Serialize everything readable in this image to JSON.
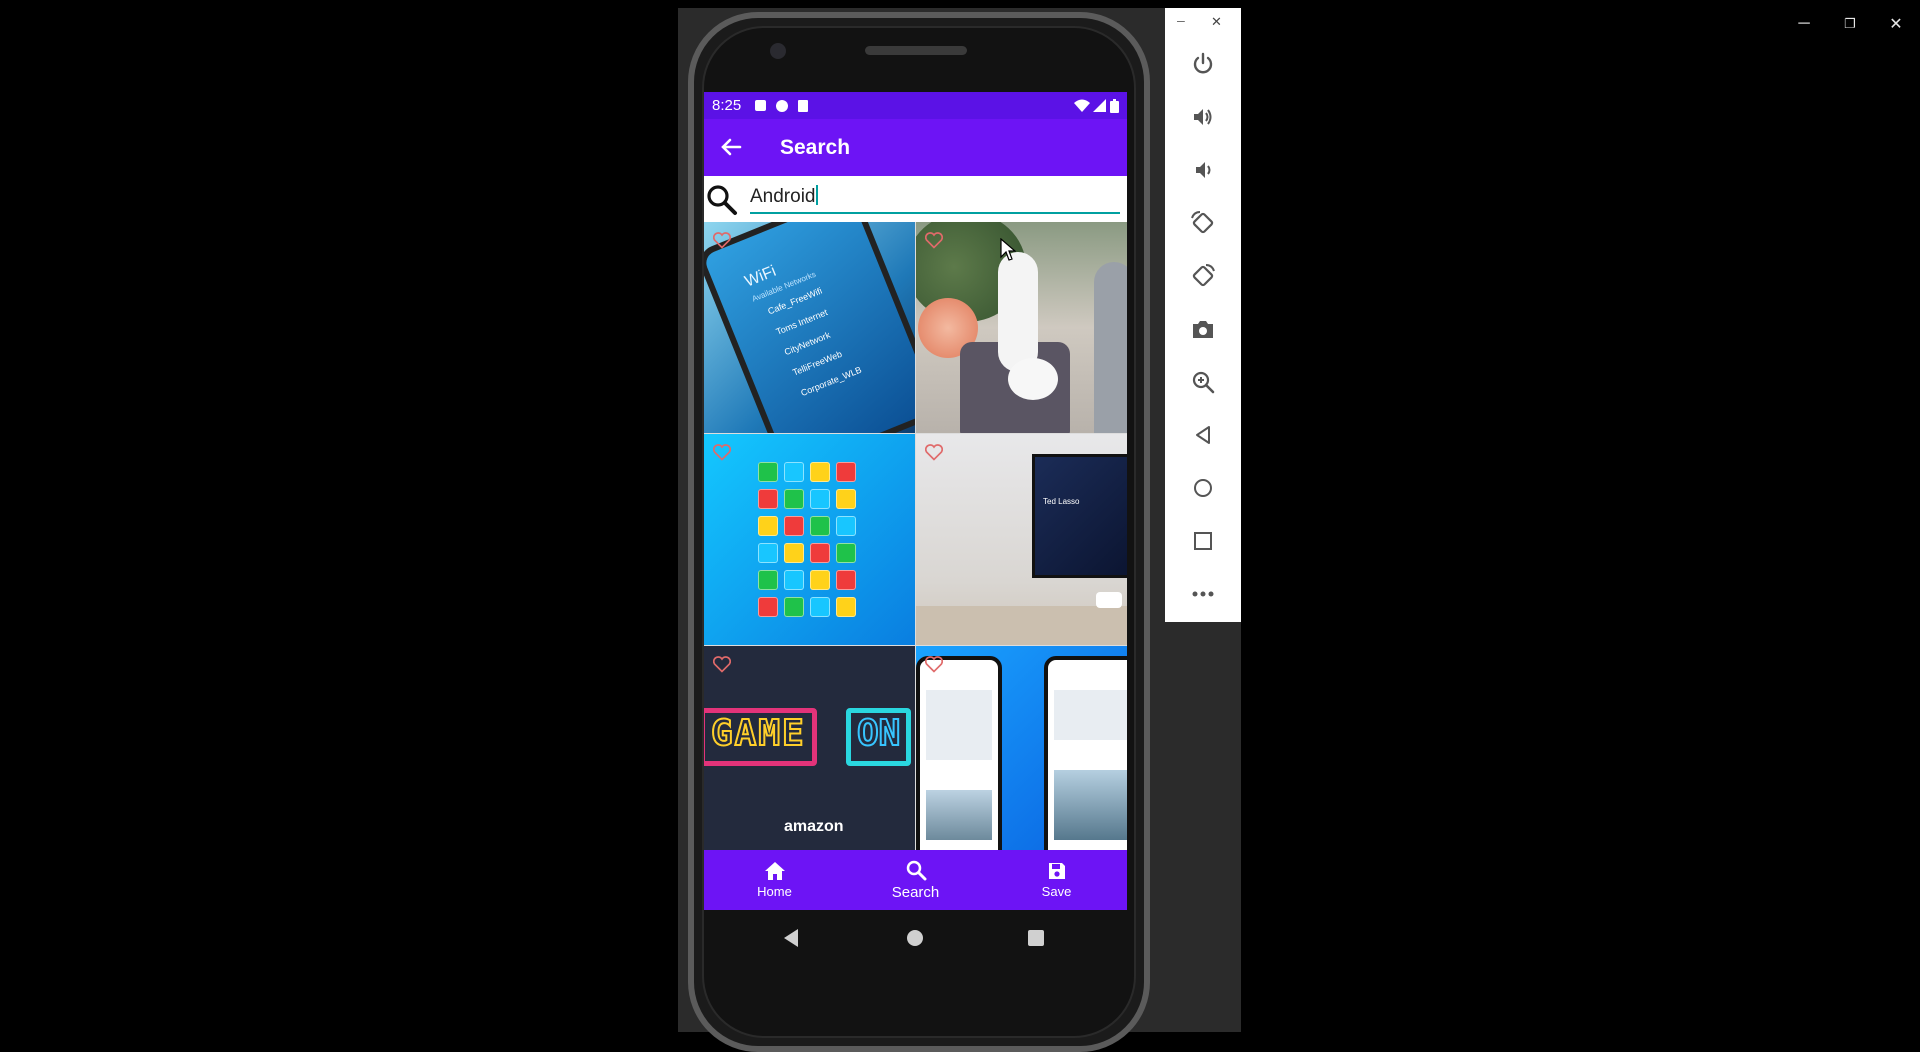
{
  "window_controls": {
    "minimize": "─",
    "restore": "❐",
    "close": "✕"
  },
  "status_bar": {
    "time": "8:25"
  },
  "app_bar": {
    "title": "Search"
  },
  "search": {
    "value": "Android",
    "placeholder": ""
  },
  "bottom_nav": {
    "items": [
      {
        "label": "Home",
        "icon": "home-icon"
      },
      {
        "label": "Search",
        "icon": "search-icon"
      },
      {
        "label": "Save",
        "icon": "save-icon"
      }
    ]
  },
  "tiles": {
    "wifi": {
      "title": "WiFi",
      "subtitle": "Available Networks",
      "networks": [
        "Cafe_FreeWifi",
        "Toms Internet",
        "CityNetwork",
        "TelliFreeWeb",
        "Corporate_WLB"
      ]
    },
    "tv": {
      "label": "Ted Lasso"
    },
    "game": {
      "word1": "GAME",
      "word2": "ON",
      "brand": "amazon"
    }
  },
  "tool_panel": {
    "tools": [
      "power-icon",
      "volume-up-icon",
      "volume-down-icon",
      "rotate-left-icon",
      "rotate-right-icon",
      "camera-icon",
      "zoom-icon",
      "back-icon",
      "home-circle-icon",
      "overview-icon",
      "more-icon"
    ]
  },
  "colors": {
    "primary": "#6d14f5",
    "status": "#5b12e6",
    "accent": "#00a0a0"
  }
}
